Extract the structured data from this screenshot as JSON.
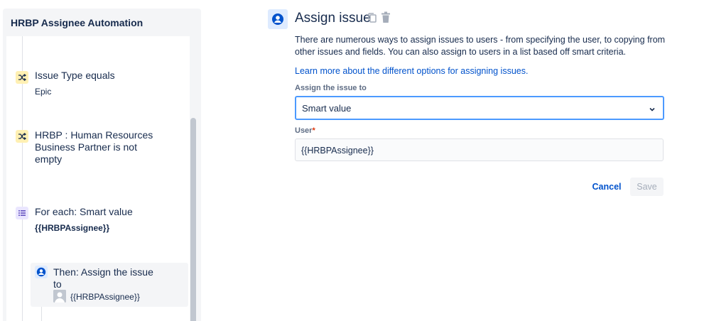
{
  "sidebar": {
    "title": "HRBP Assignee Automation",
    "steps": [
      {
        "icon": "shuffle-icon",
        "title": "Issue Type equals",
        "sub": "Epic"
      },
      {
        "icon": "shuffle-icon",
        "title": "HRBP : Human Resources Business Partner is not empty",
        "sub": ""
      },
      {
        "icon": "list-icon",
        "title": "For each: Smart value",
        "sub": "{{HRBPAssignee}}"
      },
      {
        "icon": "user-circle-icon",
        "title": "Then: Assign the issue to",
        "sub": "{{HRBPAssignee}}"
      }
    ]
  },
  "panel": {
    "title": "Assign issue",
    "description": "There are numerous ways to assign issues to users - from specifying the user, to copying from other issues and fields. You can also assign to users in a list based off smart criteria.",
    "learn_more": "Learn more about the different options for assigning issues.",
    "assign_label": "Assign the issue to",
    "assign_value": "Smart value",
    "user_label": "User",
    "user_required": "*",
    "user_value": "{{HRBPAssignee}}",
    "cancel_label": "Cancel",
    "save_label": "Save"
  },
  "colors": {
    "accent": "#0052CC",
    "focus_border": "#4C9AFF",
    "sidebar_bg": "#F4F5F7",
    "condition_icon_bg": "#FFF0B3",
    "branch_icon_bg": "#EAE6FF",
    "action_icon_bg": "#DEEBFF",
    "required": "#DE350B"
  }
}
